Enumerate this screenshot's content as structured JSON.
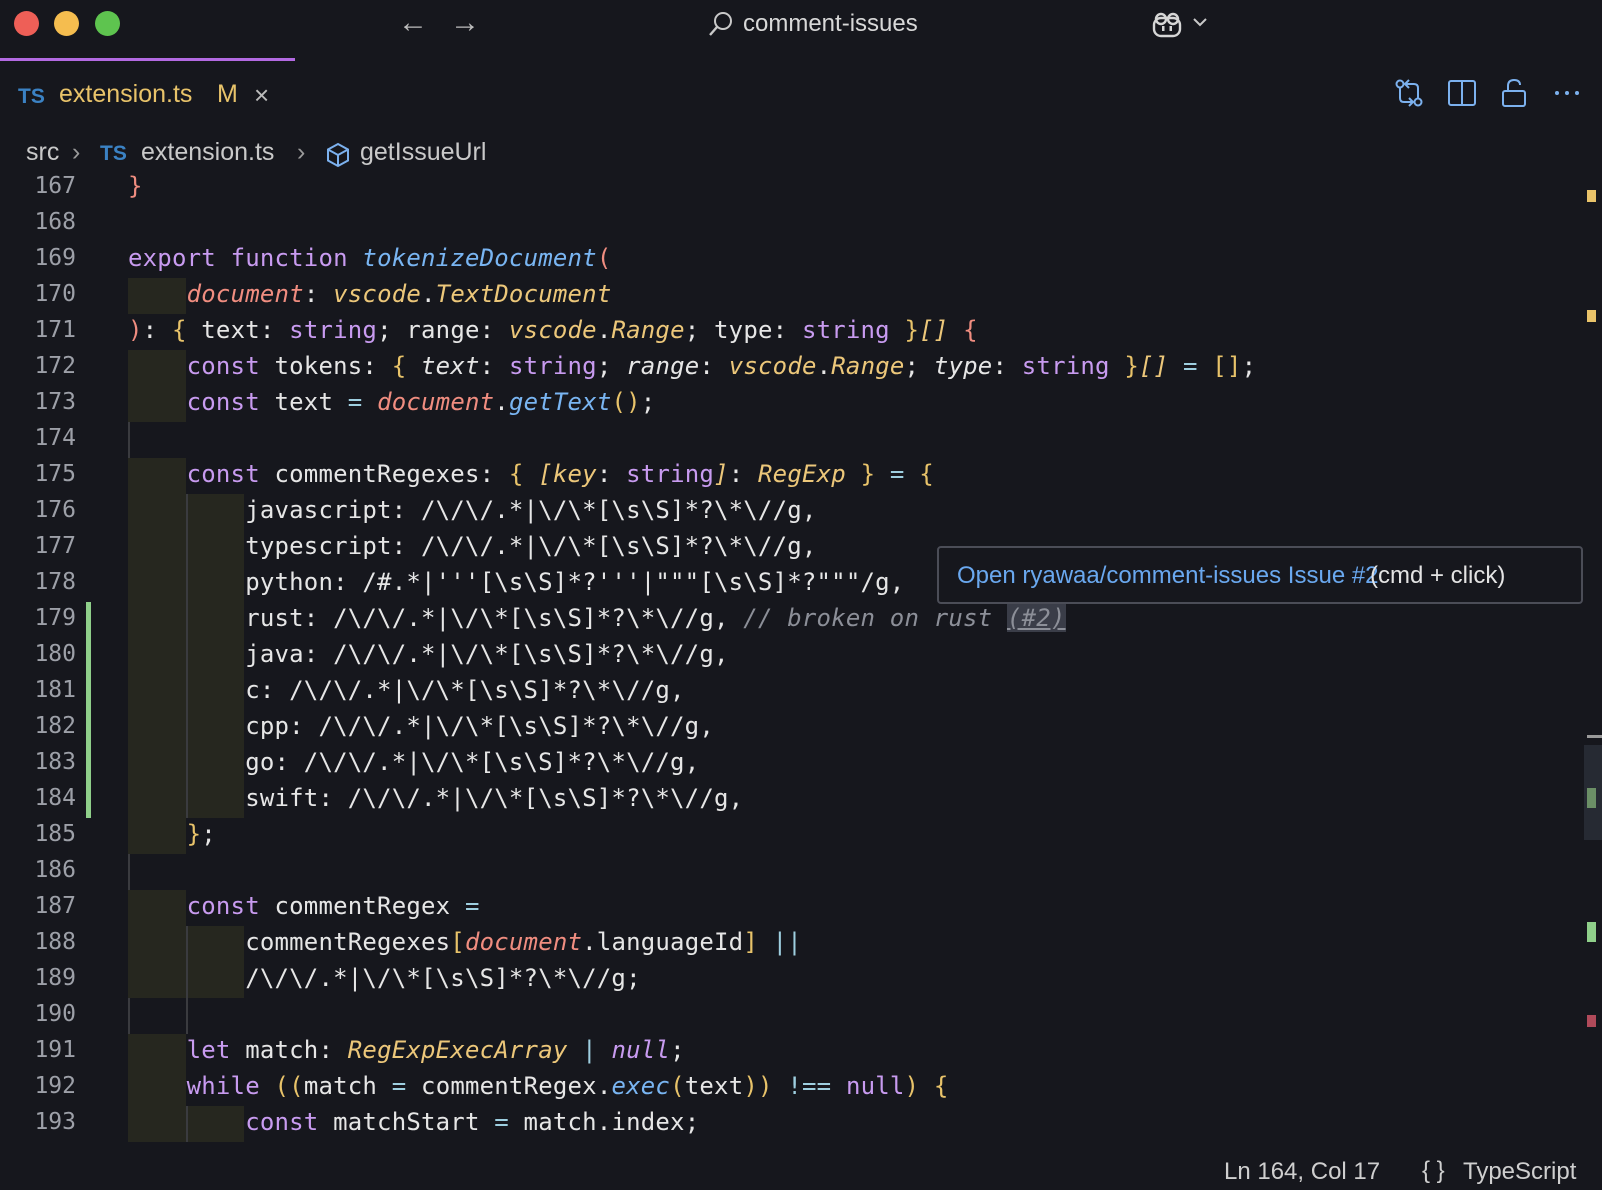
{
  "window": {
    "title": "comment-issues",
    "back_icon": "arrow-left-icon",
    "forward_icon": "arrow-right-icon",
    "copilot_icon": "copilot-icon"
  },
  "tab": {
    "lang_badge": "TS",
    "file_name": "extension.ts",
    "modified_flag": "M",
    "close_glyph": "×"
  },
  "toolbar_icons": [
    "open-changes-icon",
    "split-editor-icon",
    "lock-icon",
    "more-actions-icon"
  ],
  "breadcrumb": {
    "folder": "src",
    "lang_badge": "TS",
    "file": "extension.ts",
    "symbol": "getIssueUrl"
  },
  "editor": {
    "line_numbers": [
      "167",
      "168",
      "169",
      "170",
      "171",
      "172",
      "173",
      "174",
      "175",
      "176",
      "177",
      "178",
      "179",
      "180",
      "181",
      "182",
      "183",
      "184",
      "185",
      "186",
      "187",
      "188",
      "189",
      "190",
      "191",
      "192",
      "193"
    ]
  },
  "tooltip": {
    "link_text": "Open ryawaa/comment-issues Issue #2",
    "hint_text": "(cmd + click)"
  },
  "status": {
    "position": "Ln 164, Col 17",
    "language_icon": "{ }",
    "language": "TypeScript"
  },
  "colors": {
    "background": "#16171d",
    "keyword": "#c89bf0",
    "function": "#79b5f2",
    "parameter": "#f08d80",
    "type": "#ecc77a",
    "link": "#6aa8ef",
    "added_line": "#8fcf8a",
    "active_tab_accent": "#b36ae2"
  }
}
